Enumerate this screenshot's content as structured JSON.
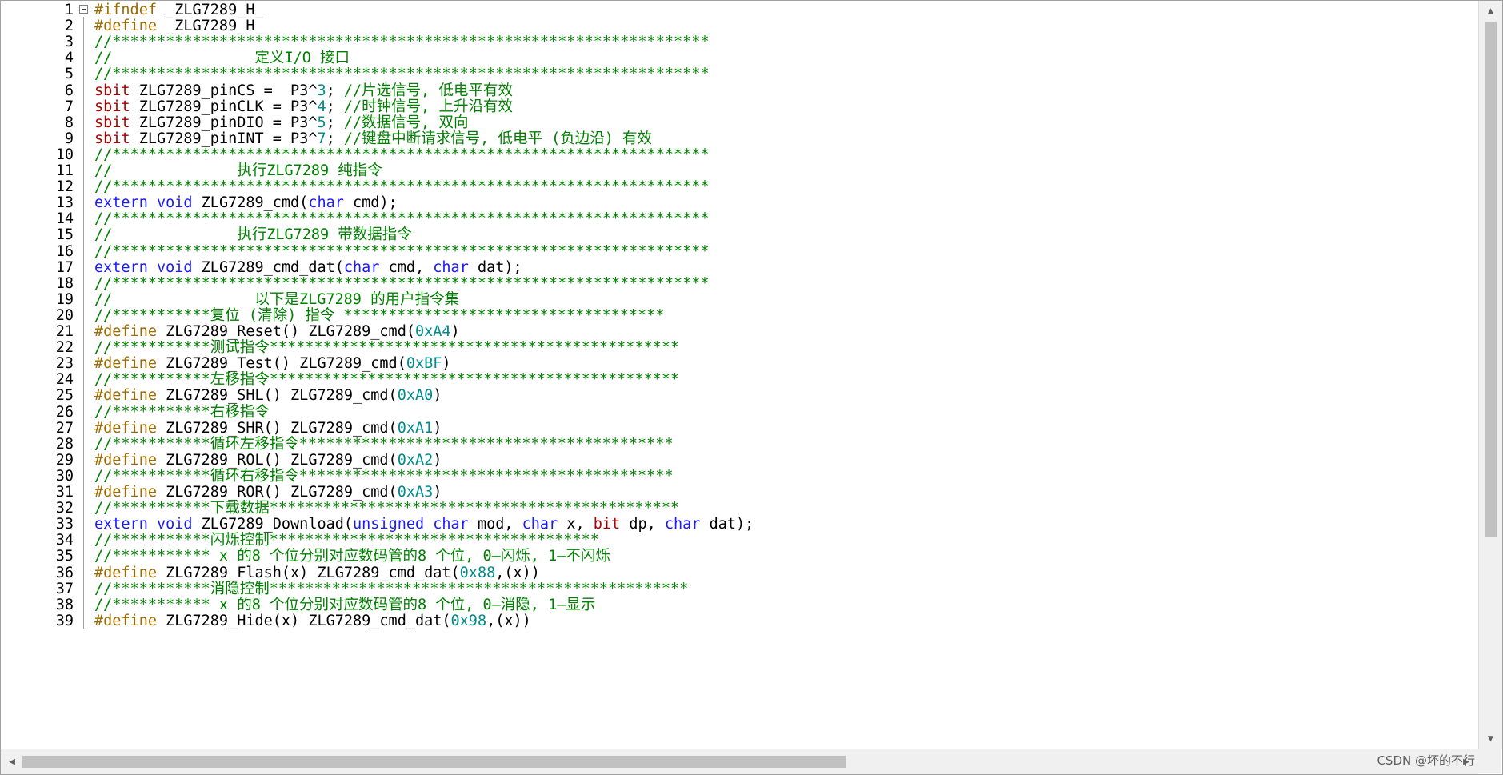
{
  "editor": {
    "colors": {
      "keyword": "#1a1aff",
      "preprocessor": "#9b6b00",
      "sbit": "#b00000",
      "number": "#008b8b",
      "comment": "#008000",
      "text": "#000000"
    },
    "lines": [
      {
        "n": "1",
        "fold": true,
        "parts": [
          [
            "pp",
            "#ifndef"
          ],
          [
            "id",
            " _ZLG7289_H_"
          ]
        ]
      },
      {
        "n": "2",
        "parts": [
          [
            "pp",
            "#define"
          ],
          [
            "id",
            " _ZLG7289_H_"
          ]
        ]
      },
      {
        "n": "3",
        "parts": [
          [
            "cm",
            "//*******************************************************************"
          ]
        ]
      },
      {
        "n": "4",
        "parts": [
          [
            "cm",
            "//                定义I/O 接口"
          ]
        ]
      },
      {
        "n": "5",
        "parts": [
          [
            "cm",
            "//*******************************************************************"
          ]
        ]
      },
      {
        "n": "6",
        "parts": [
          [
            "sbit",
            "sbit"
          ],
          [
            "id",
            " ZLG7289_pinCS =  P3^"
          ],
          [
            "num",
            "3"
          ],
          [
            "id",
            "; "
          ],
          [
            "cm",
            "//片选信号, 低电平有效"
          ]
        ]
      },
      {
        "n": "7",
        "parts": [
          [
            "sbit",
            "sbit"
          ],
          [
            "id",
            " ZLG7289_pinCLK = P3^"
          ],
          [
            "num",
            "4"
          ],
          [
            "id",
            "; "
          ],
          [
            "cm",
            "//时钟信号, 上升沿有效"
          ]
        ]
      },
      {
        "n": "8",
        "parts": [
          [
            "sbit",
            "sbit"
          ],
          [
            "id",
            " ZLG7289_pinDIO = P3^"
          ],
          [
            "num",
            "5"
          ],
          [
            "id",
            "; "
          ],
          [
            "cm",
            "//数据信号, 双向"
          ]
        ]
      },
      {
        "n": "9",
        "parts": [
          [
            "sbit",
            "sbit"
          ],
          [
            "id",
            " ZLG7289_pinINT = P3^"
          ],
          [
            "num",
            "7"
          ],
          [
            "id",
            "; "
          ],
          [
            "cm",
            "//键盘中断请求信号, 低电平 (负边沿) 有效"
          ]
        ]
      },
      {
        "n": "10",
        "parts": [
          [
            "cm",
            "//*******************************************************************"
          ]
        ]
      },
      {
        "n": "11",
        "parts": [
          [
            "cm",
            "//              执行ZLG7289 纯指令"
          ]
        ]
      },
      {
        "n": "12",
        "parts": [
          [
            "cm",
            "//*******************************************************************"
          ]
        ]
      },
      {
        "n": "13",
        "parts": [
          [
            "kw",
            "extern"
          ],
          [
            "id",
            " "
          ],
          [
            "kw",
            "void"
          ],
          [
            "id",
            " ZLG7289_cmd("
          ],
          [
            "kw",
            "char"
          ],
          [
            "id",
            " cmd);"
          ]
        ]
      },
      {
        "n": "14",
        "parts": [
          [
            "cm",
            "//*******************************************************************"
          ]
        ]
      },
      {
        "n": "15",
        "parts": [
          [
            "cm",
            "//              执行ZLG7289 带数据指令"
          ]
        ]
      },
      {
        "n": "16",
        "parts": [
          [
            "cm",
            "//*******************************************************************"
          ]
        ]
      },
      {
        "n": "17",
        "parts": [
          [
            "kw",
            "extern"
          ],
          [
            "id",
            " "
          ],
          [
            "kw",
            "void"
          ],
          [
            "id",
            " ZLG7289_cmd_dat("
          ],
          [
            "kw",
            "char"
          ],
          [
            "id",
            " cmd, "
          ],
          [
            "kw",
            "char"
          ],
          [
            "id",
            " dat);"
          ]
        ]
      },
      {
        "n": "18",
        "parts": [
          [
            "cm",
            "//*******************************************************************"
          ]
        ]
      },
      {
        "n": "19",
        "parts": [
          [
            "cm",
            "//                以下是ZLG7289 的用户指令集"
          ]
        ]
      },
      {
        "n": "20",
        "parts": [
          [
            "cm",
            "//***********复位 (清除) 指令 ************************************"
          ]
        ]
      },
      {
        "n": "21",
        "parts": [
          [
            "pp",
            "#define"
          ],
          [
            "id",
            " ZLG7289_Reset() ZLG7289_cmd("
          ],
          [
            "num",
            "0xA4"
          ],
          [
            "id",
            ")"
          ]
        ]
      },
      {
        "n": "22",
        "parts": [
          [
            "cm",
            "//***********测试指令**********************************************"
          ]
        ]
      },
      {
        "n": "23",
        "parts": [
          [
            "pp",
            "#define"
          ],
          [
            "id",
            " ZLG7289_Test() ZLG7289_cmd("
          ],
          [
            "num",
            "0xBF"
          ],
          [
            "id",
            ")"
          ]
        ]
      },
      {
        "n": "24",
        "parts": [
          [
            "cm",
            "//***********左移指令**********************************************"
          ]
        ]
      },
      {
        "n": "25",
        "parts": [
          [
            "pp",
            "#define"
          ],
          [
            "id",
            " ZLG7289_SHL() ZLG7289_cmd("
          ],
          [
            "num",
            "0xA0"
          ],
          [
            "id",
            ")"
          ]
        ]
      },
      {
        "n": "26",
        "parts": [
          [
            "cm",
            "//***********右移指令"
          ]
        ]
      },
      {
        "n": "27",
        "parts": [
          [
            "pp",
            "#define"
          ],
          [
            "id",
            " ZLG7289_SHR() ZLG7289_cmd("
          ],
          [
            "num",
            "0xA1"
          ],
          [
            "id",
            ")"
          ]
        ]
      },
      {
        "n": "28",
        "parts": [
          [
            "cm",
            "//***********循环左移指令******************************************"
          ]
        ]
      },
      {
        "n": "29",
        "parts": [
          [
            "pp",
            "#define"
          ],
          [
            "id",
            " ZLG7289_ROL() ZLG7289_cmd("
          ],
          [
            "num",
            "0xA2"
          ],
          [
            "id",
            ")"
          ]
        ]
      },
      {
        "n": "30",
        "parts": [
          [
            "cm",
            "//***********循环右移指令******************************************"
          ]
        ]
      },
      {
        "n": "31",
        "parts": [
          [
            "pp",
            "#define"
          ],
          [
            "id",
            " ZLG7289_ROR() ZLG7289_cmd("
          ],
          [
            "num",
            "0xA3"
          ],
          [
            "id",
            ")"
          ]
        ]
      },
      {
        "n": "32",
        "parts": [
          [
            "cm",
            "//***********下载数据**********************************************"
          ]
        ]
      },
      {
        "n": "33",
        "parts": [
          [
            "kw",
            "extern"
          ],
          [
            "id",
            " "
          ],
          [
            "kw",
            "void"
          ],
          [
            "id",
            " ZLG7289_Download("
          ],
          [
            "kw",
            "unsigned"
          ],
          [
            "id",
            " "
          ],
          [
            "kw",
            "char"
          ],
          [
            "id",
            " mod, "
          ],
          [
            "kw",
            "char"
          ],
          [
            "id",
            " x, "
          ],
          [
            "sbit",
            "bit"
          ],
          [
            "id",
            " dp, "
          ],
          [
            "kw",
            "char"
          ],
          [
            "id",
            " dat);"
          ]
        ]
      },
      {
        "n": "34",
        "parts": [
          [
            "cm",
            "//***********闪烁控制*************************************"
          ]
        ]
      },
      {
        "n": "35",
        "parts": [
          [
            "cm",
            "//*********** x 的8 个位分别对应数码管的8 个位, 0—闪烁, 1—不闪烁"
          ]
        ]
      },
      {
        "n": "36",
        "parts": [
          [
            "pp",
            "#define"
          ],
          [
            "id",
            " ZLG7289_Flash(x) ZLG7289_cmd_dat("
          ],
          [
            "num",
            "0x88"
          ],
          [
            "id",
            ",(x))"
          ]
        ]
      },
      {
        "n": "37",
        "parts": [
          [
            "cm",
            "//***********消隐控制***********************************************"
          ]
        ]
      },
      {
        "n": "38",
        "parts": [
          [
            "cm",
            "//*********** x 的8 个位分别对应数码管的8 个位, 0—消隐, 1—显示"
          ]
        ]
      },
      {
        "n": "39",
        "parts": [
          [
            "pp",
            "#define"
          ],
          [
            "id",
            " ZLG7289_Hide(x) ZLG7289_cmd_dat("
          ],
          [
            "num",
            "0x98"
          ],
          [
            "id",
            ",(x))"
          ]
        ]
      }
    ]
  },
  "scrollbars": {
    "up_arrow": "▲",
    "down_arrow": "▼",
    "left_arrow": "◀",
    "right_arrow": "▶"
  },
  "watermark": "CSDN @坏的不行"
}
